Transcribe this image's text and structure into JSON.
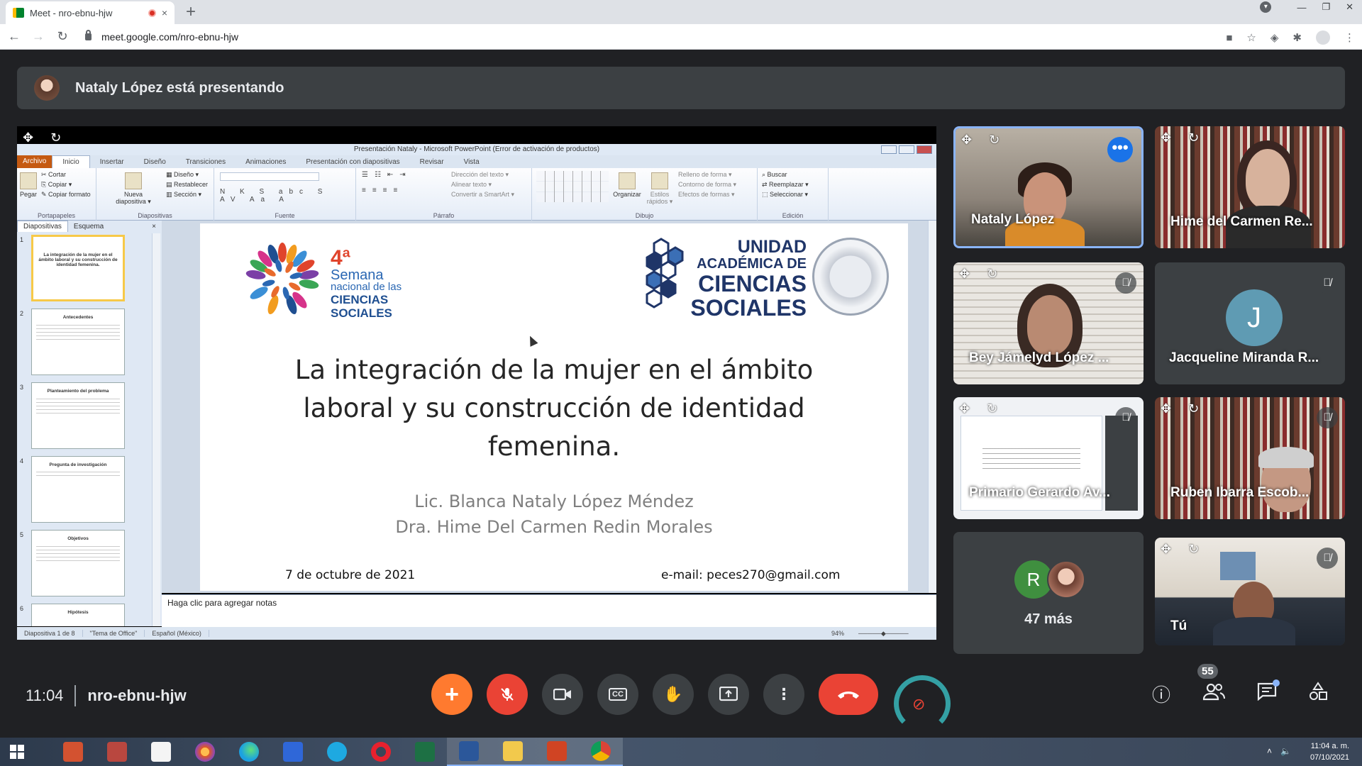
{
  "browser": {
    "tab_title": "Meet - nro-ebnu-hjw",
    "tab_close": "×",
    "new_tab": "+",
    "url": "meet.google.com/nro-ebnu-hjw",
    "back": "←",
    "forward": "→",
    "reload": "↻",
    "win_min": "—",
    "win_max": "❐",
    "win_close": "✕"
  },
  "banner": {
    "text": "Nataly López está presentando"
  },
  "presentation": {
    "window_title": "Presentación Nataly - Microsoft PowerPoint (Error de activación de productos)",
    "ribbon_tabs": [
      "Archivo",
      "Inicio",
      "Insertar",
      "Diseño",
      "Transiciones",
      "Animaciones",
      "Presentación con diapositivas",
      "Revisar",
      "Vista"
    ],
    "groups": {
      "portapapeles": {
        "label": "Portapapeles",
        "pegar": "Pegar",
        "cortar": "Cortar",
        "copiar": "Copiar ▾",
        "copiar_formato": "Copiar formato"
      },
      "diapositivas": {
        "label": "Diapositivas",
        "nueva": "Nueva diapositiva ▾",
        "diseno": "Diseño ▾",
        "restablecer": "Restablecer",
        "seccion": "Sección ▾"
      },
      "fuente": {
        "label": "Fuente",
        "buttons": "N K S abc S AV Aa A"
      },
      "parrafo": {
        "label": "Párrafo",
        "direccion": "Dirección del texto ▾",
        "alinear": "Alinear texto ▾",
        "smartart": "Convertir a SmartArt ▾"
      },
      "dibujo": {
        "label": "Dibujo",
        "organizar": "Organizar",
        "estilos": "Estilos rápidos ▾",
        "relleno": "Relleno de forma ▾",
        "contorno": "Contorno de forma ▾",
        "efectos": "Efectos de formas ▾"
      },
      "edicion": {
        "label": "Edición",
        "buscar": "Buscar",
        "reemplazar": "Reemplazar ▾",
        "seleccionar": "Seleccionar ▾"
      }
    },
    "panel_tabs": [
      "Diapositivas",
      "Esquema"
    ],
    "thumbnails": [
      {
        "num": "1",
        "title": "La integración de la mujer en el ámbito laboral y su construcción de identidad femenina."
      },
      {
        "num": "2",
        "title": "Antecedentes"
      },
      {
        "num": "3",
        "title": "Planteamiento del problema"
      },
      {
        "num": "4",
        "title": "Pregunta de investigación"
      },
      {
        "num": "5",
        "title": "Objetivos"
      },
      {
        "num": "6",
        "title": "Hipótesis"
      }
    ],
    "slide": {
      "logo1": {
        "number": "4ª",
        "line1": "Semana",
        "line2": "nacional de las",
        "line3": "CIENCIAS",
        "line4": "SOCIALES"
      },
      "logo2": {
        "line1": "UNIDAD",
        "line2": "ACADÉMICA DE",
        "line3": "CIENCIAS",
        "line4": "SOCIALES"
      },
      "title": "La integración de la mujer en el ámbito laboral y su construcción de identidad femenina.",
      "author1": "Lic. Blanca Nataly López Méndez",
      "author2": "Dra. Hime Del Carmen Redin Morales",
      "date": "7 de octubre de 2021",
      "email": "e-mail: peces270@gmail.com"
    },
    "notes_placeholder": "Haga clic para agregar notas",
    "status": {
      "slide": "Diapositiva 1 de 8",
      "theme": "\"Tema de Office\"",
      "lang": "Español (México)",
      "zoom": "94%"
    }
  },
  "participants": [
    {
      "name": "Nataly López",
      "active": true,
      "more": "•••"
    },
    {
      "name": "Hime del Carmen Re..."
    },
    {
      "name": "Bey Jámelyd López ..."
    },
    {
      "name": "Jacqueline Miranda R...",
      "initial": "J"
    },
    {
      "name": "Primario Gerardo Av..."
    },
    {
      "name": "Ruben Ibarra Escob..."
    },
    {
      "name": "47 más",
      "initial": "R"
    },
    {
      "name": "Tú"
    }
  ],
  "meeting": {
    "time": "11:04",
    "code": "nro-ebnu-hjw",
    "participants_count": "55"
  },
  "taskbar": {
    "time": "11:04 a. m.",
    "date": "07/10/2021"
  },
  "colors": {
    "meet_bg": "#202124",
    "tile_bg": "#3c4043",
    "hangup": "#ea4335",
    "activity": "#ff7a2f",
    "active_border": "#8ab4f8"
  }
}
